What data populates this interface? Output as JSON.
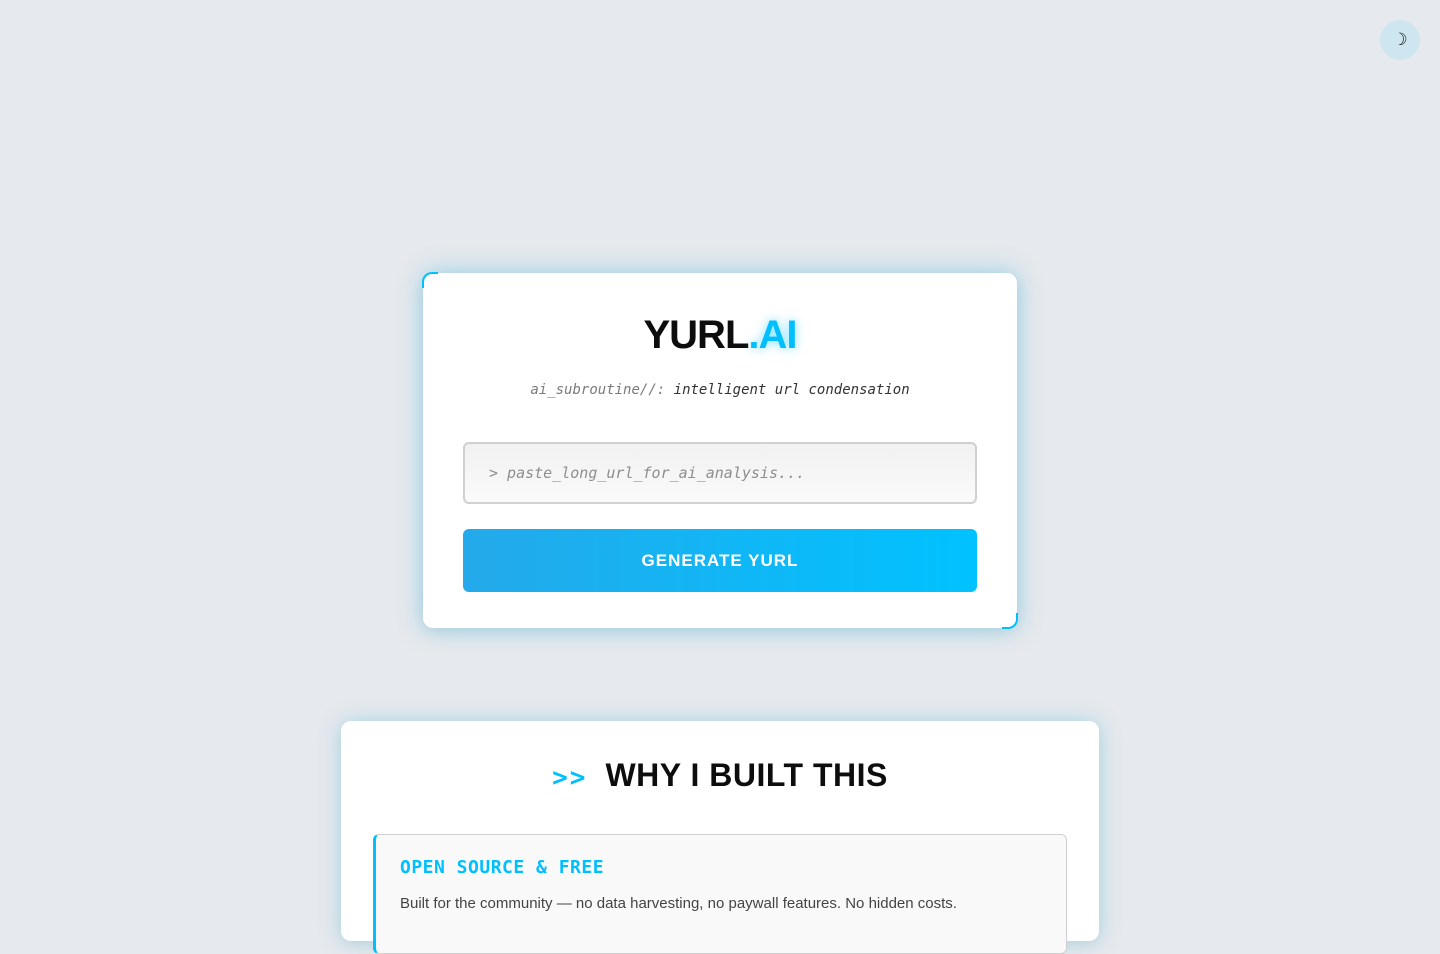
{
  "theme_toggle": {
    "icon": "moon-icon",
    "glyph": "☽"
  },
  "brand": {
    "name": "YURL",
    "accent": ".AI"
  },
  "tagline": {
    "prefix": "ai_subroutine//:",
    "text": "intelligent url condensation"
  },
  "url_input": {
    "placeholder": "> paste_long_url_for_ai_analysis...",
    "value": ""
  },
  "generate_button": {
    "label": "GENERATE YURL"
  },
  "about": {
    "arrows": ">>",
    "heading": "WHY I BUILT THIS",
    "feature": {
      "title": "OPEN SOURCE & FREE",
      "text": "Built for the community — no data harvesting, no paywall features. No hidden costs."
    }
  },
  "colors": {
    "accent": "#00bfff",
    "background": "#e6e9ed",
    "button_gradient_start": "#24a9ea",
    "button_gradient_end": "#00c2ff"
  }
}
